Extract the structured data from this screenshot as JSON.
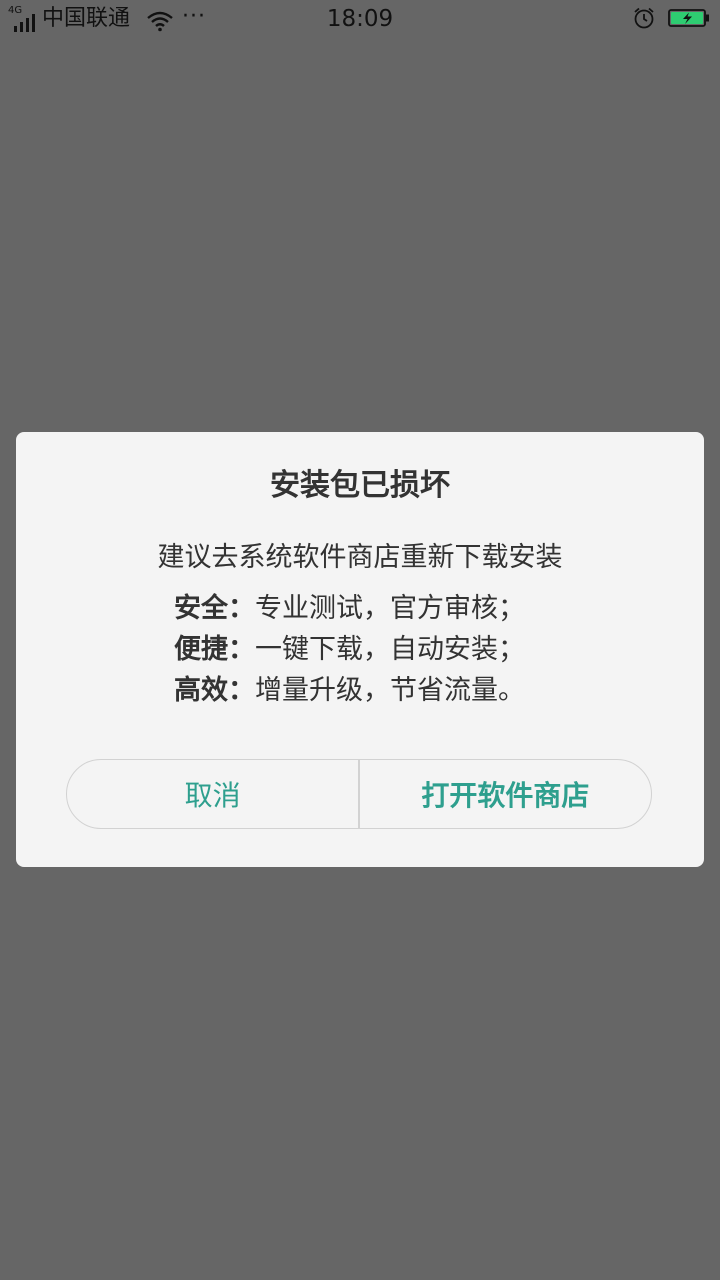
{
  "status_bar": {
    "network_type": "4G",
    "carrier": "中国联通",
    "more": "···",
    "time": "18:09",
    "icons": {
      "signal": "signal-icon",
      "wifi": "wifi-icon",
      "alarm": "alarm-icon",
      "battery": "battery-charging-icon"
    },
    "battery_color": "#2ecc71"
  },
  "dialog": {
    "title": "安装包已损坏",
    "subtitle": "建议去系统软件商店重新下载安装",
    "features": [
      {
        "key": "安全：",
        "value": "专业测试，官方审核；"
      },
      {
        "key": "便捷：",
        "value": "一键下载，自动安装；"
      },
      {
        "key": "高效：",
        "value": "增量升级，节省流量。"
      }
    ],
    "cancel_label": "取消",
    "open_store_label": "打开软件商店",
    "accent_color": "#2e9f8e"
  }
}
